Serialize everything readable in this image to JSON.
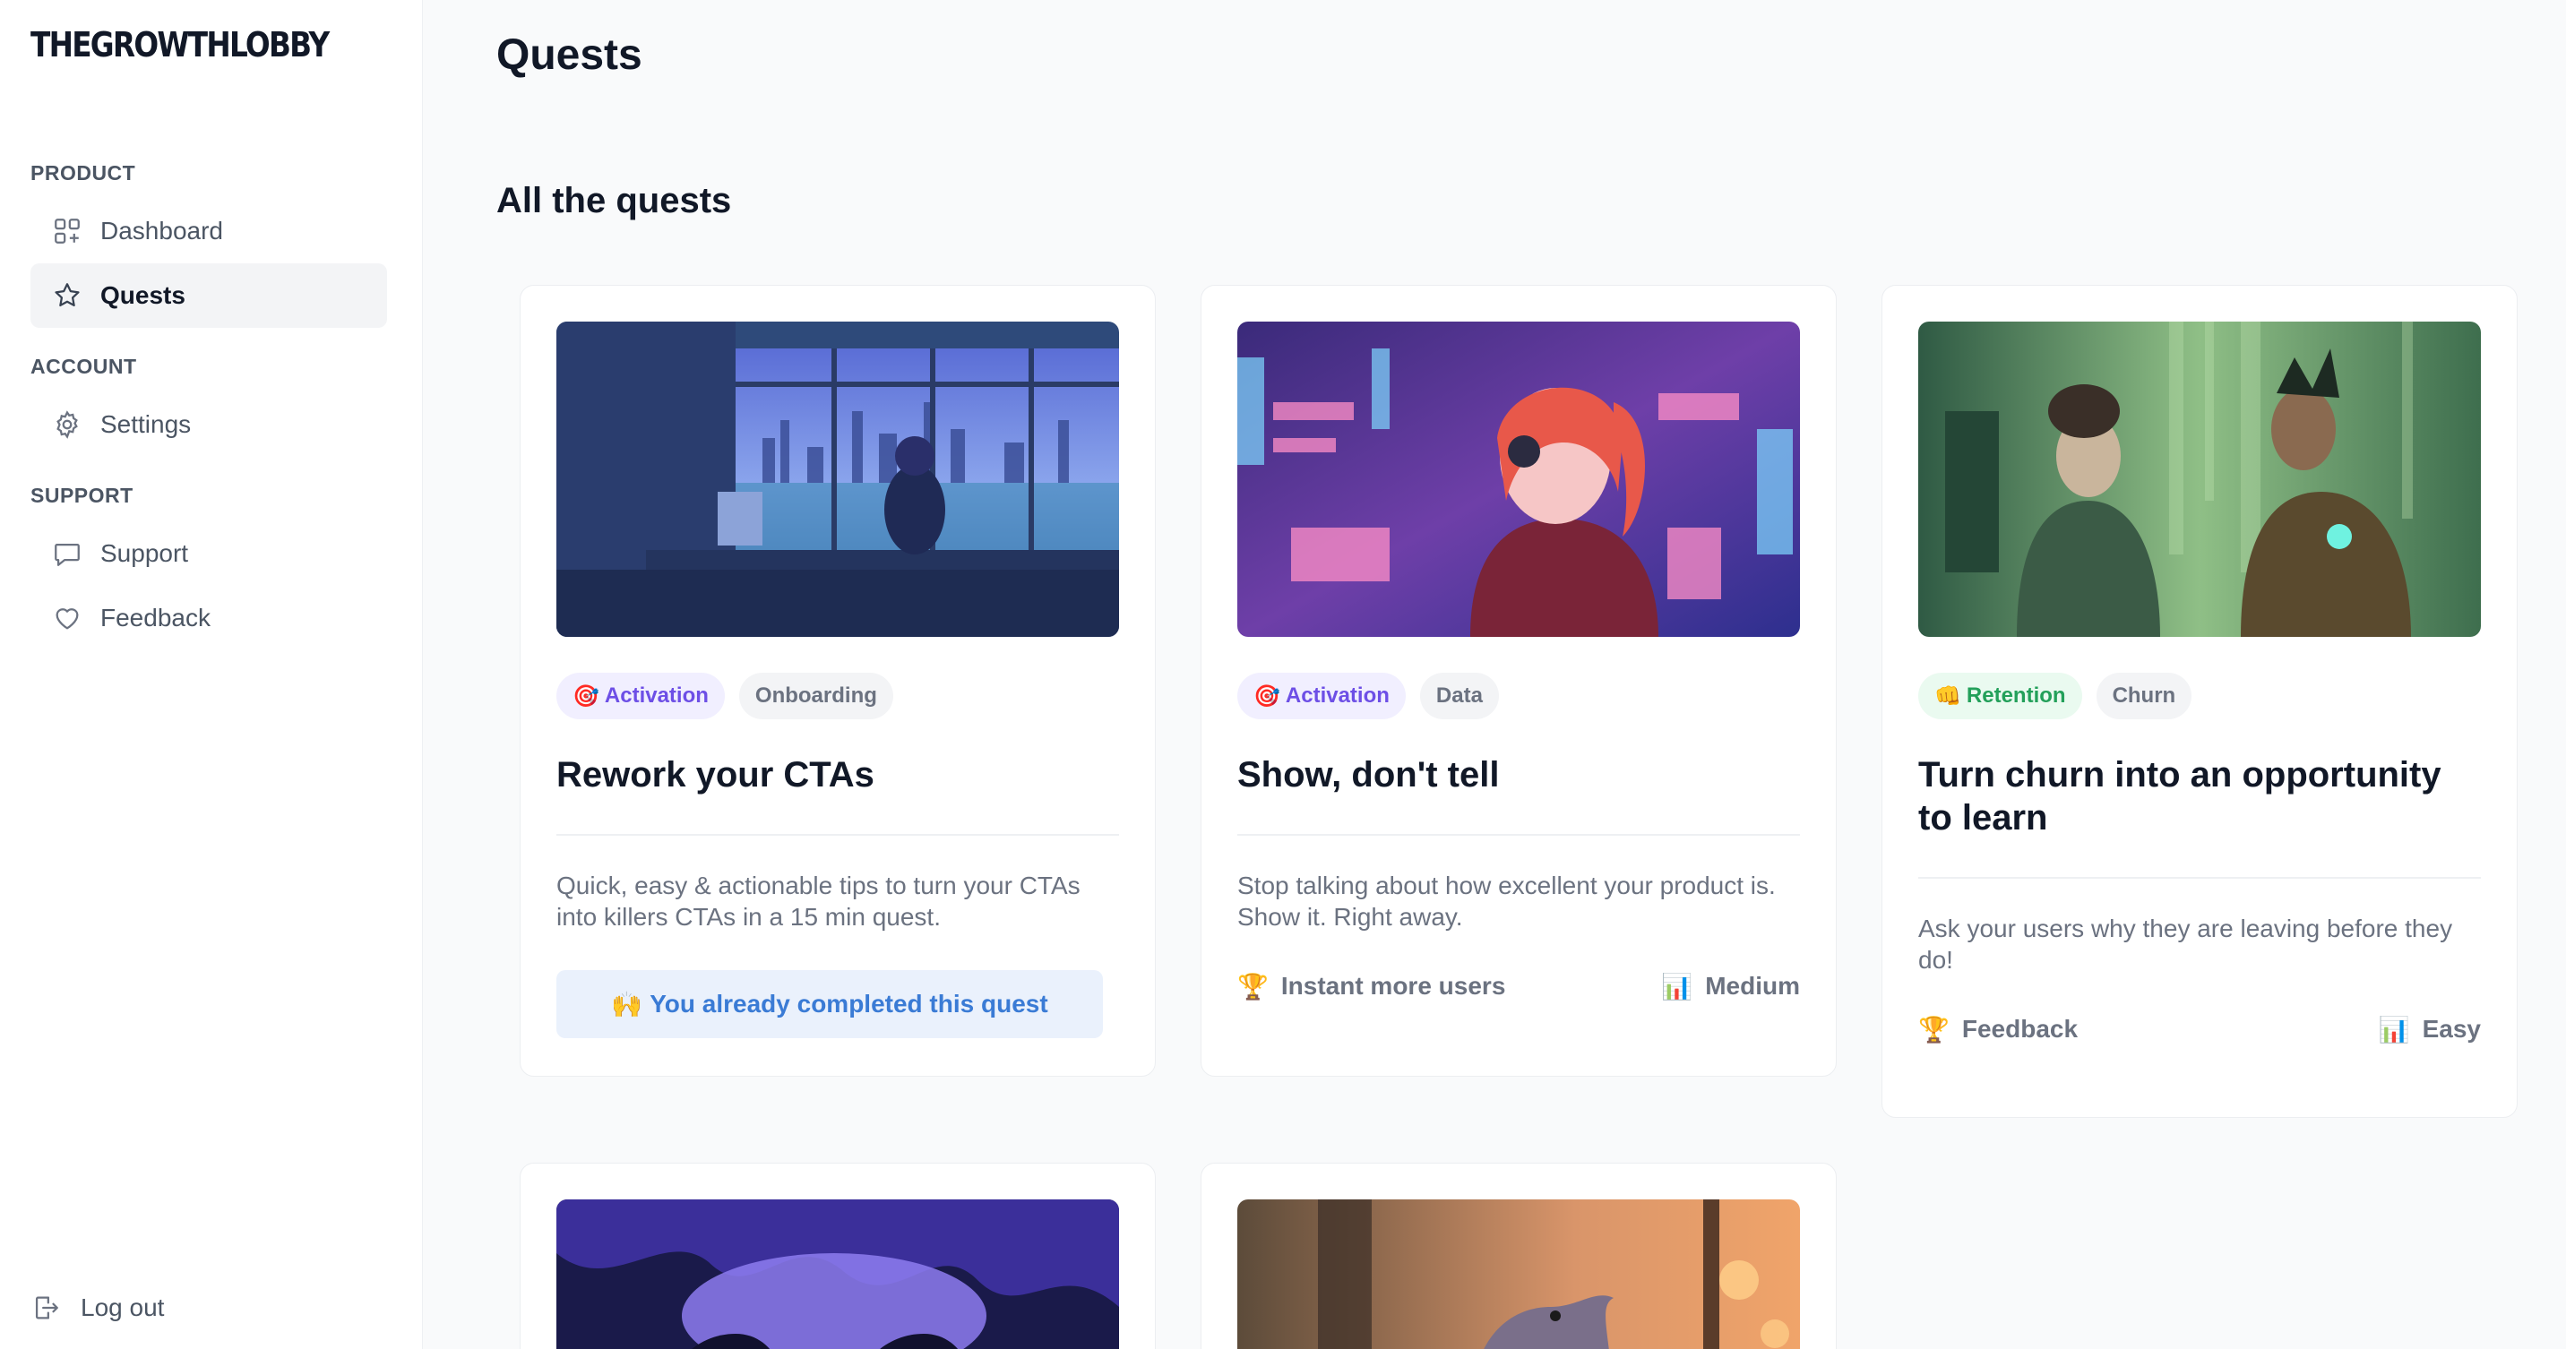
{
  "brand": {
    "logo_text": "THEGROWTHLOBBY"
  },
  "sidebar": {
    "sections": [
      {
        "title": "PRODUCT",
        "items": [
          {
            "label": "Dashboard",
            "icon": "dashboard-grid-icon"
          },
          {
            "label": "Quests",
            "icon": "star-icon",
            "active": true
          }
        ]
      },
      {
        "title": "ACCOUNT",
        "items": [
          {
            "label": "Settings",
            "icon": "gear-icon"
          }
        ]
      },
      {
        "title": "SUPPORT",
        "items": [
          {
            "label": "Support",
            "icon": "chat-bubble-icon"
          },
          {
            "label": "Feedback",
            "icon": "heart-icon"
          }
        ]
      }
    ],
    "logout_label": "Log out"
  },
  "main": {
    "page_title": "Quests",
    "section_heading": "All the quests",
    "cards": [
      {
        "image": "cozy-room-city-view-illustration",
        "tags": [
          {
            "label": "Activation",
            "emoji": "🎯",
            "color": "#6d4fe6"
          },
          {
            "label": "Onboarding"
          }
        ],
        "title": "Rework your CTAs",
        "description": "Quick, easy & actionable tips to turn your CTAs into killers CTAs in a 15 min quest.",
        "completed_label": "You already completed this quest",
        "completed_emoji": "🙌"
      },
      {
        "image": "neon-girl-headphones-illustration",
        "tags": [
          {
            "label": "Activation",
            "emoji": "🎯",
            "color": "#6d4fe6"
          },
          {
            "label": "Data"
          }
        ],
        "title": "Show, don't tell",
        "description": "Stop talking about how excellent your product is. Show it. Right away.",
        "goal_emoji": "🏆",
        "goal": "Instant more users",
        "difficulty_emoji": "📊",
        "difficulty": "Medium"
      },
      {
        "image": "green-cyberpunk-couple-illustration",
        "tags": [
          {
            "label": "Retention",
            "emoji": "👊",
            "color": "#23a05a"
          },
          {
            "label": "Churn"
          }
        ],
        "title": "Turn churn into an opportunity to learn",
        "description": "Ask your users why they are leaving before they do!",
        "goal_emoji": "🏆",
        "goal": "Feedback",
        "difficulty_emoji": "📊",
        "difficulty": "Easy"
      },
      {
        "image": "purple-cave-illustration"
      },
      {
        "image": "orange-bird-window-illustration"
      }
    ]
  }
}
